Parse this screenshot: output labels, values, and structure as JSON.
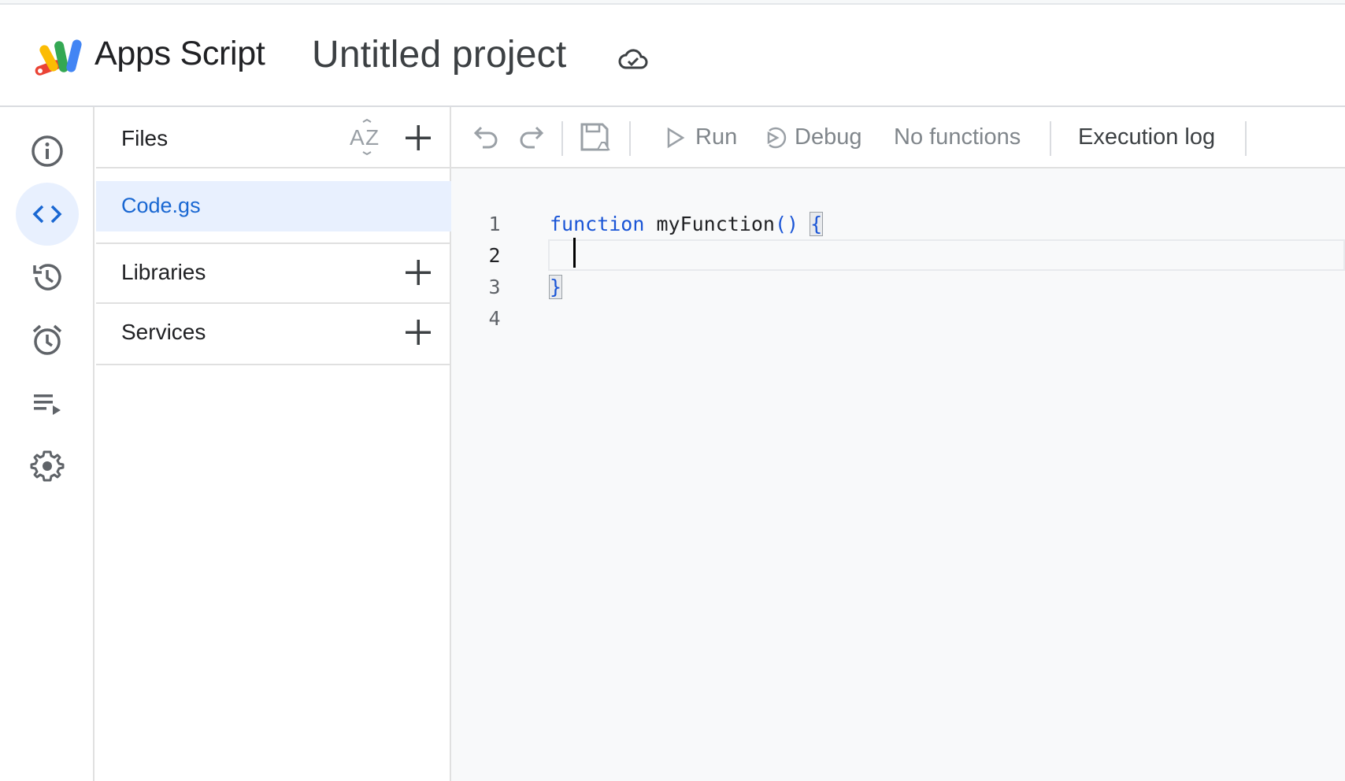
{
  "header": {
    "app_title": "Apps Script",
    "project_title": "Untitled project",
    "cloud_status_icon": "cloud-check-icon"
  },
  "rail": {
    "items": [
      {
        "name": "overview",
        "icon": "info-icon",
        "active": false
      },
      {
        "name": "editor",
        "icon": "code-icon",
        "active": true
      },
      {
        "name": "project-history",
        "icon": "history-icon",
        "active": false
      },
      {
        "name": "triggers",
        "icon": "alarm-icon",
        "active": false
      },
      {
        "name": "executions",
        "icon": "playlist-play-icon",
        "active": false
      },
      {
        "name": "project-settings",
        "icon": "gear-icon",
        "active": false
      }
    ]
  },
  "files_panel": {
    "files_label": "Files",
    "sort_icon": "sort-az-icon",
    "files": [
      {
        "name": "Code.gs",
        "selected": true
      }
    ],
    "libraries_label": "Libraries",
    "services_label": "Services"
  },
  "toolbar": {
    "run_label": "Run",
    "debug_label": "Debug",
    "function_select": "No functions",
    "execution_log_label": "Execution log"
  },
  "editor": {
    "lines": [
      {
        "number": "1",
        "keyword": "function",
        "name": " myFunction",
        "parens": "()",
        "space": " ",
        "brace": "{"
      },
      {
        "number": "2"
      },
      {
        "number": "3",
        "brace": "}"
      },
      {
        "number": "4"
      }
    ]
  },
  "colors": {
    "accent_blue": "#1967d2",
    "active_bg": "#e8f0fe",
    "editor_bg": "#f8f9fa",
    "keyword_blue": "#1a55d6"
  }
}
